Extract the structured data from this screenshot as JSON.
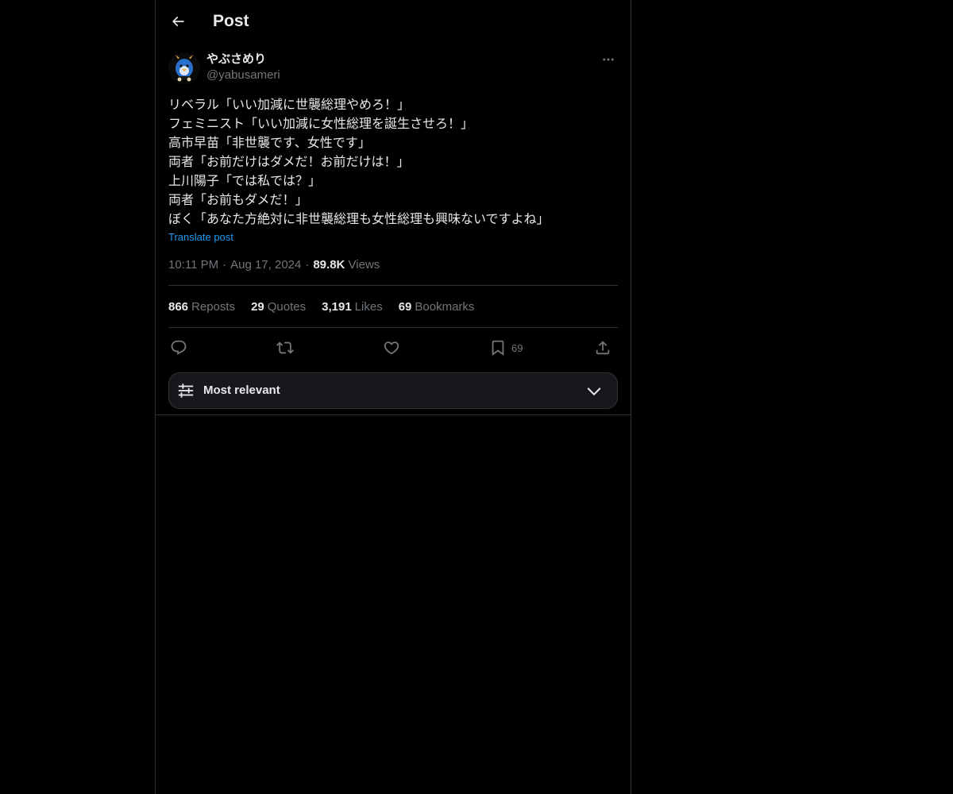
{
  "header": {
    "title": "Post",
    "back_icon": "arrow-left-icon"
  },
  "author": {
    "display_name": "やぶさめり",
    "handle": "@yabusameri",
    "avatar_icon": "avatar-image",
    "more_icon": "more-dots-icon"
  },
  "post": {
    "text": "リベラル「いい加減に世襲総理やめろ！」\nフェミニスト「いい加減に女性総理を誕生させろ！」\n高市早苗「非世襲です、女性です」\n両者「お前だけはダメだ！お前だけは！」\n上川陽子「では私では？」\n両者「お前もダメだ！」\nぼく「あなた方絶対に非世襲総理も女性総理も興味ないですよね」",
    "translate_label": "Translate post",
    "time": "10:11 PM",
    "date": "Aug 17, 2024",
    "separator": "·",
    "views_count": "89.8K",
    "views_label": "Views"
  },
  "stats": {
    "reposts": {
      "count": "866",
      "label": "Reposts"
    },
    "quotes": {
      "count": "29",
      "label": "Quotes"
    },
    "likes": {
      "count": "3,191",
      "label": "Likes"
    },
    "bookmarks": {
      "count": "69",
      "label": "Bookmarks"
    }
  },
  "actions": {
    "reply_icon": "reply-icon",
    "repost_icon": "repost-icon",
    "like_icon": "heart-icon",
    "bookmark_icon": "bookmark-icon",
    "bookmark_count": "69",
    "share_icon": "share-icon"
  },
  "sort": {
    "label": "Most relevant",
    "icon": "sliders-icon",
    "chevron": "chevron-down-icon"
  },
  "colors": {
    "background": "#000000",
    "text": "#e7e9ea",
    "secondary": "#71767b",
    "link": "#1d9bf0",
    "border": "#2f3336"
  }
}
